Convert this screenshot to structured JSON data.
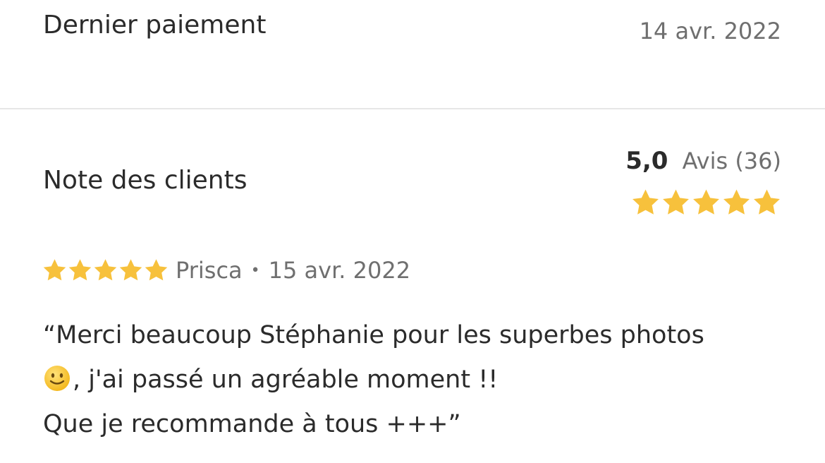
{
  "payment": {
    "label": "Dernier paiement",
    "date": "14 avr. 2022",
    "amount_partial": "…"
  },
  "rating": {
    "label": "Note des clients",
    "score": "5,0",
    "count_label": "Avis (36)",
    "stars": 5,
    "star_color": "#f7c13c"
  },
  "review": {
    "stars": 5,
    "author": "Prisca",
    "separator": "•",
    "date": "15 avr. 2022",
    "line1": "“Merci beaucoup Stéphanie pour les superbes photos",
    "line2_emoji": "slightly-smiling-face-icon",
    "line2_text": ", j'ai passé un agréable moment !!",
    "line3": "Que je recommande à tous +++”"
  },
  "colors": {
    "text": "#2b2b2b",
    "muted": "#6f6f6f",
    "accent_green": "#5a9e2f",
    "divider": "#e6e6e6"
  }
}
